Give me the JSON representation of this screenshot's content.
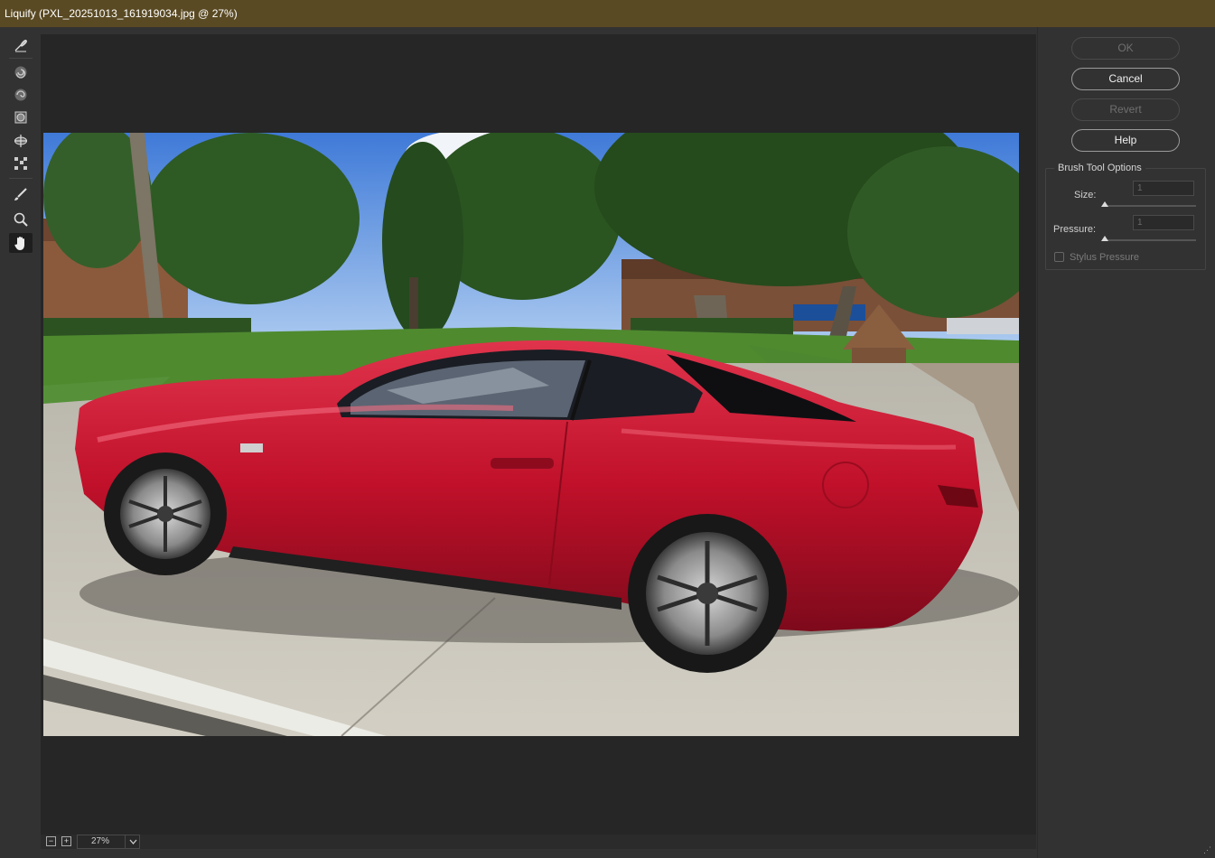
{
  "window": {
    "title": "Liquify (PXL_20251013_161919034.jpg @ 27%)"
  },
  "tools": [
    {
      "name": "forward-warp-tool"
    },
    {
      "name": "twirl-clockwise-tool"
    },
    {
      "name": "pucker-tool"
    },
    {
      "name": "bloat-tool"
    },
    {
      "name": "push-left-tool"
    },
    {
      "name": "freeze-mask-tool"
    },
    {
      "name": "thaw-mask-tool"
    },
    {
      "name": "zoom-tool"
    },
    {
      "name": "hand-tool"
    }
  ],
  "buttons": {
    "ok": "OK",
    "cancel": "Cancel",
    "revert": "Revert",
    "help": "Help"
  },
  "brush_options": {
    "title": "Brush Tool Options",
    "size_label": "Size:",
    "size_value": "1",
    "pressure_label": "Pressure:",
    "pressure_value": "1",
    "stylus_label": "Stylus Pressure",
    "stylus_checked": false
  },
  "status": {
    "zoom": "27%"
  },
  "colors": {
    "titlebar": "#5a4a23",
    "car": "#c8102e"
  }
}
